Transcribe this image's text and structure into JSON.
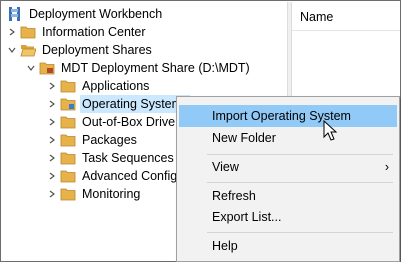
{
  "tree": {
    "root": {
      "label": "Deployment Workbench",
      "icon": "workbench-icon"
    },
    "information_center": {
      "label": "Information Center",
      "icon": "folder-icon"
    },
    "deployment_shares": {
      "label": "Deployment Shares",
      "icon": "folder-open-icon"
    },
    "mdt_share": {
      "label": "MDT Deployment Share (D:\\MDT)",
      "icon": "deployment-share-icon"
    },
    "children": [
      {
        "label": "Applications",
        "icon": "folder-icon"
      },
      {
        "label": "Operating Systems",
        "icon": "folder-icon",
        "selected": true
      },
      {
        "label": "Out-of-Box Drivers",
        "icon": "folder-icon"
      },
      {
        "label": "Packages",
        "icon": "folder-icon"
      },
      {
        "label": "Task Sequences",
        "icon": "folder-icon"
      },
      {
        "label": "Advanced Configuration",
        "icon": "folder-icon"
      },
      {
        "label": "Monitoring",
        "icon": "folder-icon"
      }
    ]
  },
  "list": {
    "column_header": "Name"
  },
  "context_menu": {
    "items": [
      {
        "label": "Import Operating System",
        "highlighted": true
      },
      {
        "label": "New Folder"
      },
      {
        "label": "View",
        "submenu_glyph": "›"
      },
      {
        "label": "Refresh"
      },
      {
        "label": "Export List..."
      },
      {
        "label": "Help"
      }
    ]
  },
  "colors": {
    "menu_highlight": "#91c9f7",
    "selection": "#cce8ff",
    "folder": "#e8b24b"
  }
}
